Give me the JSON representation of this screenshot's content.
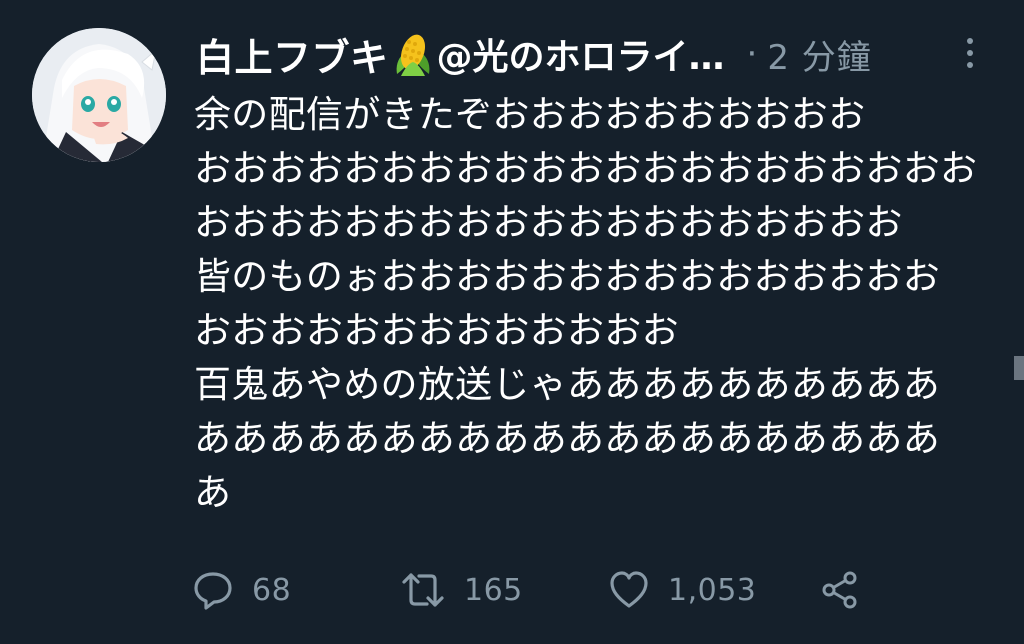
{
  "user": {
    "display_name": "白上フブキ",
    "badge_icon": "corn-icon",
    "handle": "@光のホロライ…",
    "separator": "·",
    "time": "2 分鐘"
  },
  "tweet": {
    "lines": [
      "余の配信がきたぞおおおおおおおおおお",
      "おおおおおおおおおおおおおおおおおおおおお",
      "おおおおおおおおおおおおおおおおおおお",
      "皆のものぉおおおおおおおおおおおおおおお",
      "おおおおおおおおおおおおお",
      "百鬼あやめの放送じゃああああああああああ",
      "ああああああああああああああああああああ",
      "あ"
    ]
  },
  "actions": {
    "reply": {
      "icon": "reply-icon",
      "count": "68"
    },
    "retweet": {
      "icon": "retweet-icon",
      "count": "165"
    },
    "like": {
      "icon": "heart-icon",
      "count": "1,053"
    },
    "share": {
      "icon": "share-icon"
    }
  },
  "colors": {
    "background": "#15202b",
    "text_primary": "#ffffff",
    "text_secondary": "#8899a6"
  }
}
